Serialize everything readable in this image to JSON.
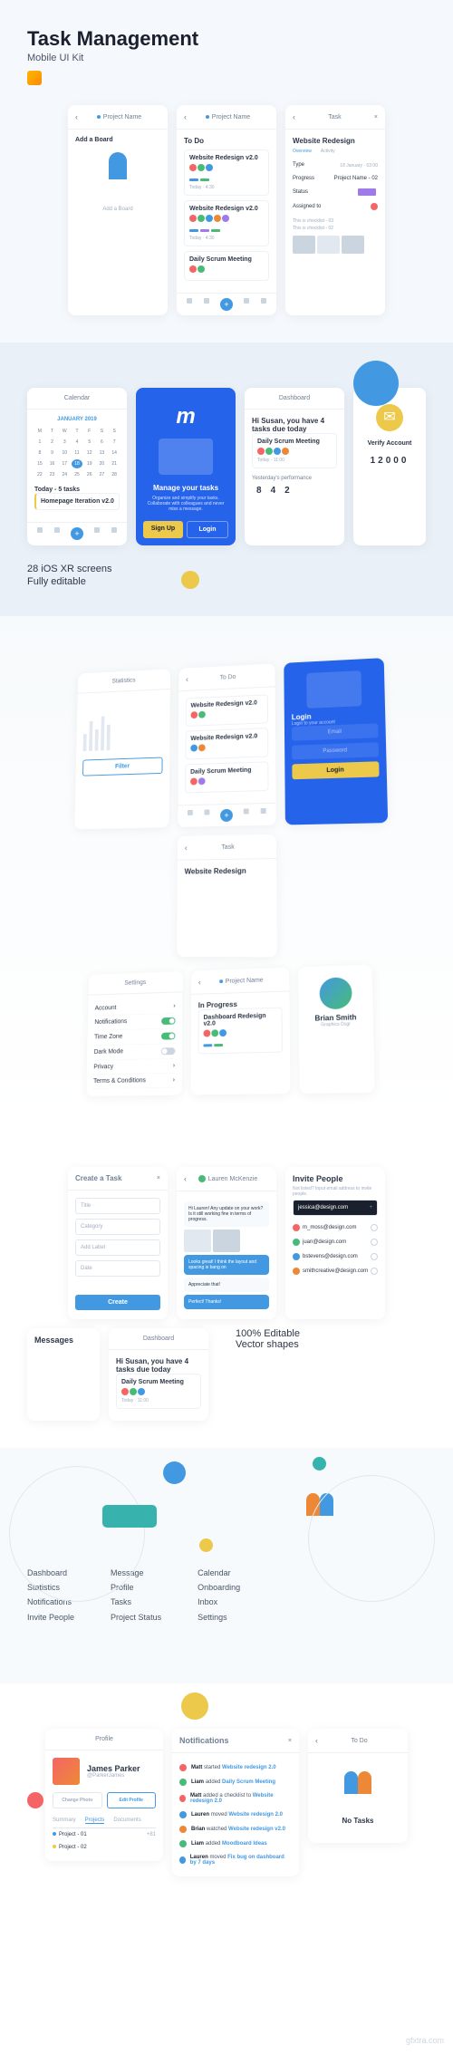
{
  "hero": {
    "title": "Task Management",
    "subtitle": "Mobile UI Kit"
  },
  "screens": {
    "addBoard": {
      "header": "Project Name",
      "title": "Add a Board",
      "cta": "Add a Board"
    },
    "todo": {
      "header": "Project Name",
      "heading": "To Do",
      "cards": [
        {
          "title": "Website Redesign v2.0",
          "meta": "Today · 4:30"
        },
        {
          "title": "Website Redesign v2.0",
          "meta": "Today · 4:30"
        },
        {
          "title": "Daily Scrum Meeting",
          "meta": ""
        }
      ]
    },
    "task": {
      "header": "Task",
      "title": "Website Redesign",
      "tabs": [
        "Overview",
        "Activity"
      ],
      "fields": {
        "type": "Type",
        "progress": "Progress",
        "project": "Project Name - 02",
        "status": "Status",
        "assigned": "Assigned to",
        "checklist": "This is checklist - 03",
        "checklist2": "This is checklist - 02"
      },
      "date": "18 January · 03:00"
    },
    "calendar": {
      "header": "Calendar",
      "month": "JANUARY 2019",
      "today": "Today - 5 tasks",
      "task": "Homepage Iteration v2.0"
    },
    "onboard": {
      "letter": "m",
      "title": "Manage your tasks",
      "desc": "Organize and simplify your tasks. Collaborate with colleagues and never miss a message.",
      "signup": "Sign Up",
      "login": "Login"
    },
    "dashboard": {
      "header": "Dashboard",
      "greeting": "Hi Susan, you have 4 tasks due today",
      "task": "Daily Scrum Meeting",
      "meta": "Today · 11:00",
      "perf": "Yesterday's performance"
    },
    "verify": {
      "title": "Verify Account",
      "code": "12000"
    },
    "login": {
      "title": "Login",
      "subtitle": "Login to your account",
      "email": "Email",
      "password": "Password",
      "button": "Login"
    },
    "settings": {
      "header": "Settings",
      "items": [
        "Account",
        "Notifications",
        "Time Zone",
        "Dark Mode",
        "Privacy",
        "Terms & Conditions"
      ]
    },
    "statistics": {
      "header": "Statistics",
      "filter": "Filter"
    },
    "projectBoard": {
      "header": "Project Name",
      "section": "In Progress",
      "card": "Dashboard Redesign v2.0"
    },
    "todoList": {
      "header": "To Do",
      "cards": [
        "Website Redesign v2.0",
        "Website Redesign v2.0",
        "Daily Scrum Meeting"
      ]
    },
    "profilePerson": {
      "name": "Brian Smith",
      "role": "Graphics Dsgr"
    },
    "taskDetail": {
      "header": "Task",
      "title": "Website Redesign"
    },
    "createTask": {
      "header": "Create a Task",
      "fields": [
        "Title",
        "Category",
        "Add Label",
        "Date"
      ],
      "button": "Create"
    },
    "chat": {
      "name": "Lauren McKenzie",
      "msg1": "Hi Lauren! Any update on your work? Is it still working fine in terms of progress.",
      "msg2": "Looks great! I think the layout and spacing is bang on",
      "msg3": "Appreciate that!",
      "msg4": "Perfect! Thanks!"
    },
    "invite": {
      "header": "Invite People",
      "desc": "Not listed? Input email address to invite people.",
      "email": "jessica@design.com",
      "people": [
        "m_moss@design.com",
        "juan@design.com",
        "bstevens@design.com",
        "smithcreative@design.com"
      ]
    },
    "messages": {
      "header": "Messages"
    },
    "notifications": {
      "header": "Notifications",
      "items": [
        {
          "user": "Matt",
          "action": "started",
          "target": "Website redesign 2.0"
        },
        {
          "user": "Liam",
          "action": "added",
          "target": "Daily Scrum Meeting"
        },
        {
          "user": "Matt",
          "action": "added a checklist to",
          "target": "Website redesign 2.0"
        },
        {
          "user": "Lauren",
          "action": "moved",
          "target": "Website redesign 2.0"
        },
        {
          "user": "Brian",
          "action": "watched",
          "target": "Website redesign v2.0"
        },
        {
          "user": "Liam",
          "action": "added",
          "target": "Moodboard Ideas"
        },
        {
          "user": "Lauren",
          "action": "moved",
          "target": "Fix bug on dashboard by 7 days"
        }
      ]
    },
    "profile": {
      "header": "Profile",
      "name": "James Parker",
      "handle": "@ParkerJames",
      "edit": "Edit Profile",
      "change": "Change Photo",
      "tabs": [
        "Summary",
        "Projects",
        "Documents"
      ],
      "proj1": "Project - 01",
      "proj2": "Project - 02"
    },
    "noTasks": {
      "header": "To Do",
      "title": "No Tasks"
    }
  },
  "features": {
    "line1": "28 iOS XR screens",
    "line2": "Fully editable",
    "editable": "100% Editable",
    "vector": "Vector shapes"
  },
  "pages": {
    "col1": [
      "Dashboard",
      "Statistics",
      "Notifications",
      "Invite People"
    ],
    "col2": [
      "Message",
      "Profile",
      "Tasks",
      "Project Status"
    ],
    "col3": [
      "Calendar",
      "Onboarding",
      "Inbox",
      "Settings"
    ]
  },
  "watermark": "gfxtra.com"
}
